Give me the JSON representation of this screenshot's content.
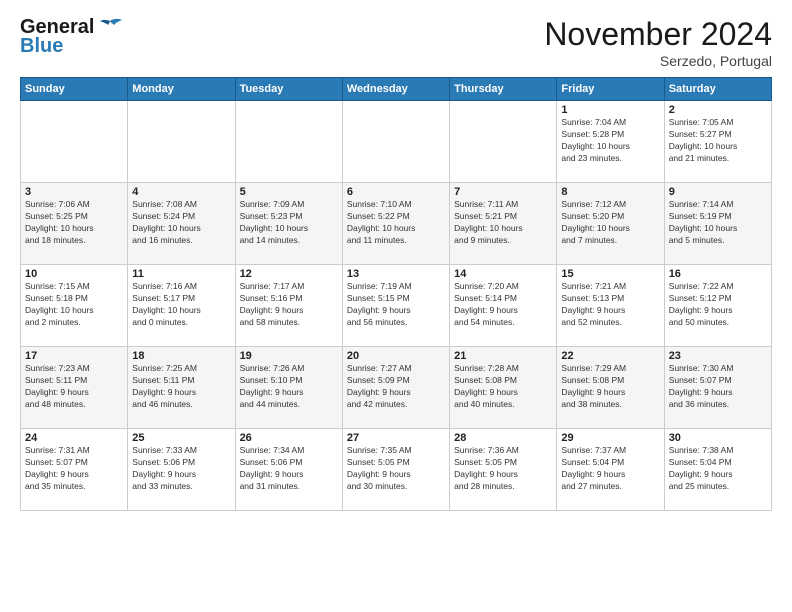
{
  "logo": {
    "line1": "General",
    "line2": "Blue"
  },
  "header": {
    "title": "November 2024",
    "location": "Serzedo, Portugal"
  },
  "weekdays": [
    "Sunday",
    "Monday",
    "Tuesday",
    "Wednesday",
    "Thursday",
    "Friday",
    "Saturday"
  ],
  "weeks": [
    [
      {
        "day": "",
        "info": ""
      },
      {
        "day": "",
        "info": ""
      },
      {
        "day": "",
        "info": ""
      },
      {
        "day": "",
        "info": ""
      },
      {
        "day": "",
        "info": ""
      },
      {
        "day": "1",
        "info": "Sunrise: 7:04 AM\nSunset: 5:28 PM\nDaylight: 10 hours\nand 23 minutes."
      },
      {
        "day": "2",
        "info": "Sunrise: 7:05 AM\nSunset: 5:27 PM\nDaylight: 10 hours\nand 21 minutes."
      }
    ],
    [
      {
        "day": "3",
        "info": "Sunrise: 7:06 AM\nSunset: 5:25 PM\nDaylight: 10 hours\nand 18 minutes."
      },
      {
        "day": "4",
        "info": "Sunrise: 7:08 AM\nSunset: 5:24 PM\nDaylight: 10 hours\nand 16 minutes."
      },
      {
        "day": "5",
        "info": "Sunrise: 7:09 AM\nSunset: 5:23 PM\nDaylight: 10 hours\nand 14 minutes."
      },
      {
        "day": "6",
        "info": "Sunrise: 7:10 AM\nSunset: 5:22 PM\nDaylight: 10 hours\nand 11 minutes."
      },
      {
        "day": "7",
        "info": "Sunrise: 7:11 AM\nSunset: 5:21 PM\nDaylight: 10 hours\nand 9 minutes."
      },
      {
        "day": "8",
        "info": "Sunrise: 7:12 AM\nSunset: 5:20 PM\nDaylight: 10 hours\nand 7 minutes."
      },
      {
        "day": "9",
        "info": "Sunrise: 7:14 AM\nSunset: 5:19 PM\nDaylight: 10 hours\nand 5 minutes."
      }
    ],
    [
      {
        "day": "10",
        "info": "Sunrise: 7:15 AM\nSunset: 5:18 PM\nDaylight: 10 hours\nand 2 minutes."
      },
      {
        "day": "11",
        "info": "Sunrise: 7:16 AM\nSunset: 5:17 PM\nDaylight: 10 hours\nand 0 minutes."
      },
      {
        "day": "12",
        "info": "Sunrise: 7:17 AM\nSunset: 5:16 PM\nDaylight: 9 hours\nand 58 minutes."
      },
      {
        "day": "13",
        "info": "Sunrise: 7:19 AM\nSunset: 5:15 PM\nDaylight: 9 hours\nand 56 minutes."
      },
      {
        "day": "14",
        "info": "Sunrise: 7:20 AM\nSunset: 5:14 PM\nDaylight: 9 hours\nand 54 minutes."
      },
      {
        "day": "15",
        "info": "Sunrise: 7:21 AM\nSunset: 5:13 PM\nDaylight: 9 hours\nand 52 minutes."
      },
      {
        "day": "16",
        "info": "Sunrise: 7:22 AM\nSunset: 5:12 PM\nDaylight: 9 hours\nand 50 minutes."
      }
    ],
    [
      {
        "day": "17",
        "info": "Sunrise: 7:23 AM\nSunset: 5:11 PM\nDaylight: 9 hours\nand 48 minutes."
      },
      {
        "day": "18",
        "info": "Sunrise: 7:25 AM\nSunset: 5:11 PM\nDaylight: 9 hours\nand 46 minutes."
      },
      {
        "day": "19",
        "info": "Sunrise: 7:26 AM\nSunset: 5:10 PM\nDaylight: 9 hours\nand 44 minutes."
      },
      {
        "day": "20",
        "info": "Sunrise: 7:27 AM\nSunset: 5:09 PM\nDaylight: 9 hours\nand 42 minutes."
      },
      {
        "day": "21",
        "info": "Sunrise: 7:28 AM\nSunset: 5:08 PM\nDaylight: 9 hours\nand 40 minutes."
      },
      {
        "day": "22",
        "info": "Sunrise: 7:29 AM\nSunset: 5:08 PM\nDaylight: 9 hours\nand 38 minutes."
      },
      {
        "day": "23",
        "info": "Sunrise: 7:30 AM\nSunset: 5:07 PM\nDaylight: 9 hours\nand 36 minutes."
      }
    ],
    [
      {
        "day": "24",
        "info": "Sunrise: 7:31 AM\nSunset: 5:07 PM\nDaylight: 9 hours\nand 35 minutes."
      },
      {
        "day": "25",
        "info": "Sunrise: 7:33 AM\nSunset: 5:06 PM\nDaylight: 9 hours\nand 33 minutes."
      },
      {
        "day": "26",
        "info": "Sunrise: 7:34 AM\nSunset: 5:06 PM\nDaylight: 9 hours\nand 31 minutes."
      },
      {
        "day": "27",
        "info": "Sunrise: 7:35 AM\nSunset: 5:05 PM\nDaylight: 9 hours\nand 30 minutes."
      },
      {
        "day": "28",
        "info": "Sunrise: 7:36 AM\nSunset: 5:05 PM\nDaylight: 9 hours\nand 28 minutes."
      },
      {
        "day": "29",
        "info": "Sunrise: 7:37 AM\nSunset: 5:04 PM\nDaylight: 9 hours\nand 27 minutes."
      },
      {
        "day": "30",
        "info": "Sunrise: 7:38 AM\nSunset: 5:04 PM\nDaylight: 9 hours\nand 25 minutes."
      }
    ]
  ]
}
